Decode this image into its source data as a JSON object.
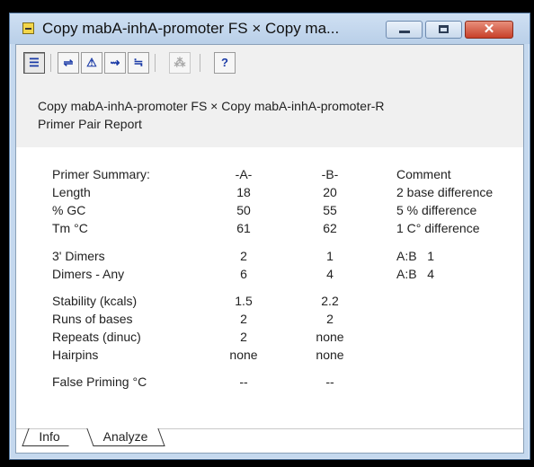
{
  "window": {
    "title": "Copy mabA-inhA-promoter FS × Copy ma...",
    "close_glyph": "✕"
  },
  "toolbar": {
    "buttons": [
      {
        "icon": "report-icon",
        "glyph": "☰"
      },
      {
        "icon": "compare-icon",
        "glyph": "⇌"
      },
      {
        "icon": "triangle-icon",
        "glyph": "⚠"
      },
      {
        "icon": "dimer-icon",
        "glyph": "⇝"
      },
      {
        "icon": "hairpin-icon",
        "glyph": "≒"
      },
      {
        "icon": "false-priming-icon",
        "glyph": "⁂"
      },
      {
        "icon": "help-icon",
        "glyph": "?"
      }
    ]
  },
  "header": {
    "line1": "Copy mabA-inhA-promoter FS × Copy mabA-inhA-promoter-R",
    "line2": "Primer Pair Report"
  },
  "report": {
    "col_headers": {
      "label": "Primer Summary:",
      "a": "-A-",
      "b": "-B-",
      "comment": "Comment"
    },
    "rows": [
      {
        "label": "Length",
        "a": "18",
        "b": "20",
        "comment": "2 base difference"
      },
      {
        "label": "% GC",
        "a": "50",
        "b": "55",
        "comment": "5 % difference"
      },
      {
        "label": "Tm °C",
        "a": "61",
        "b": "62",
        "comment": "1 C° difference"
      },
      {
        "label": "3' Dimers",
        "a": "2",
        "b": "1",
        "comment": "A:B   1"
      },
      {
        "label": "Dimers - Any",
        "a": "6",
        "b": "4",
        "comment": "A:B   4"
      },
      {
        "label": "Stability (kcals)",
        "a": "1.5",
        "b": "2.2",
        "comment": ""
      },
      {
        "label": "Runs of bases",
        "a": "2",
        "b": "2",
        "comment": ""
      },
      {
        "label": "Repeats (dinuc)",
        "a": "2",
        "b": "none",
        "comment": ""
      },
      {
        "label": "Hairpins",
        "a": "none",
        "b": "none",
        "comment": ""
      },
      {
        "label": "False Priming  °C",
        "a": "--",
        "b": "--",
        "comment": ""
      }
    ]
  },
  "tabs": {
    "info": "Info",
    "analyze": "Analyze"
  }
}
